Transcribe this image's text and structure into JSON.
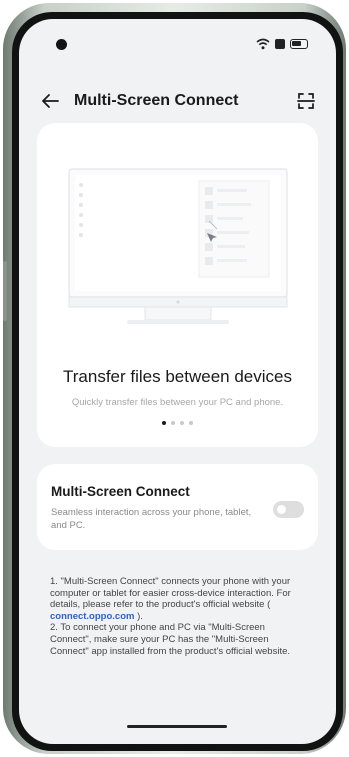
{
  "header": {
    "title": "Multi-Screen Connect",
    "back_icon": "arrow-left-icon",
    "scan_icon": "scan-icon"
  },
  "status_bar": {
    "icons": [
      "wifi-icon",
      "sim-icon",
      "battery-icon"
    ]
  },
  "hero": {
    "title": "Transfer files between devices",
    "subtitle": "Quickly transfer files between your PC and phone.",
    "page_count": 4,
    "active_page": 0
  },
  "toggle": {
    "title": "Multi-Screen Connect",
    "description": "Seamless interaction across your phone, tablet, and PC.",
    "enabled": false
  },
  "notes": {
    "line1_before_link": "1. \"Multi-Screen Connect\" connects your phone with your computer or tablet for easier cross-device interaction. For details, please refer to the product's official website ( ",
    "link": "connect.oppo.com",
    "line1_after_link": " ).",
    "line2": "2. To connect your phone and PC via \"Multi-Screen Connect\", make sure your PC has the \"Multi-Screen Connect\" app installed from the product's official website."
  }
}
